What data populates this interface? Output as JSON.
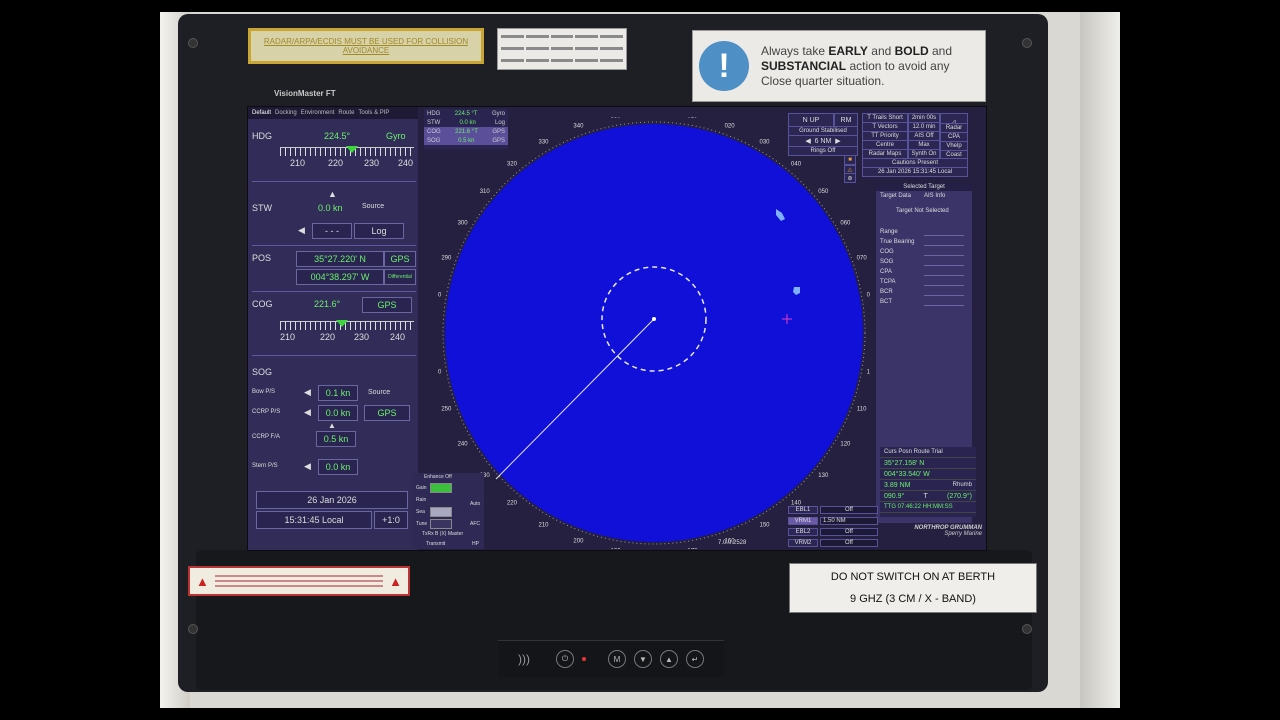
{
  "stickers": {
    "top_left_warning": "RADAR/ARPA/ECDIS MUST BE USED FOR COLLISION AVOIDANCE",
    "tip_line1": "Always take ",
    "tip_early": "EARLY",
    "tip_and": " and ",
    "tip_bold": "BOLD",
    "tip_and2": " and",
    "tip_substancial": "SUBSTANCIAL",
    "tip_line2b": " action to avoid any",
    "tip_line3": "Close quarter situation.",
    "tip_icon": "!",
    "berth_line1": "DO NOT SWITCH ON AT BERTH",
    "berth_line2": "9 GHZ (3 CM / X - BAND)",
    "brand": "VisionMaster FT"
  },
  "tabs": [
    "Default",
    "Docking",
    "Environment",
    "Route",
    "Tools & PIP"
  ],
  "left_panel": {
    "hdg_label": "HDG",
    "hdg_value": "224.5°",
    "hdg_source": "Gyro",
    "hdg_scale": [
      "210",
      "220",
      "230",
      "240"
    ],
    "stw_label": "STW",
    "stw_value": "0.0 kn",
    "stw_source_label": "Source",
    "stw_dots": "- - -",
    "stw_source": "Log",
    "pos_label": "POS",
    "pos_lat": "35°27.220' N",
    "pos_lon": "004°38.297' W",
    "pos_source": "GPS",
    "pos_mode": "Differential",
    "cog_label": "COG",
    "cog_value": "221.6°",
    "cog_source": "GPS",
    "cog_scale": [
      "210",
      "220",
      "230",
      "240"
    ],
    "sog_label": "SOG",
    "bow_label": "Bow P/S",
    "bow_value": "0.1 kn",
    "sog_source_label": "Source",
    "sog_source": "GPS",
    "ccrp_ps_label": "CCRP P/S",
    "ccrp_ps_value": "0.0 kn",
    "ccrp_fa_label": "CCRP F/A",
    "ccrp_fa_value": "0.5 kn",
    "stern_label": "Stern P/S",
    "stern_value": "0.0 kn",
    "date": "26 Jan 2026",
    "time": "15:31:45 Local",
    "tz": "+1:0"
  },
  "top_header": {
    "hdg_label": "HDG",
    "hdg_value": "224.5 °T",
    "hdg_src": "Gyro",
    "stw_label": "STW",
    "stw_value": "0.0 kn",
    "stw_src": "Log",
    "cog_label": "COG",
    "cog_value": "221.6 °T",
    "cog_src": "GPS",
    "sog_label": "SOG",
    "sog_value": "0.5 kn",
    "sog_src": "GPS"
  },
  "radar": {
    "bearings": [
      "350",
      "000",
      "010",
      "020",
      "030",
      "040",
      "050",
      "060",
      "070",
      "080",
      "090",
      "100",
      "110",
      "120",
      "130",
      "140",
      "150",
      "160",
      "170",
      "180",
      "190",
      "200",
      "210",
      "220",
      "230",
      "240",
      "250",
      "260",
      "270",
      "280",
      "290",
      "300",
      "310",
      "320",
      "330",
      "340"
    ],
    "version": "7.0.0.2528",
    "sweep_color": "#1010d8"
  },
  "right_panel": {
    "n_up": "N UP",
    "rm": "RM",
    "ground_stab": "Ground Stabilised",
    "range": "6 NM",
    "rings": "Rings Off",
    "t_trails": "T Trails Short",
    "trails_val": "2min 00s",
    "t_vectors": "T Vectors",
    "vectors_val": "12.0 min",
    "tt_priority": "TT Priority",
    "ais_off": "AIS Off",
    "centre": "Centre",
    "max": "Max",
    "radar_maps": "Radar Maps",
    "synth_on": "Synth On",
    "coast": "Coast",
    "cautions": "Cautions Present",
    "date_line": "26 Jan 2026 15:31:45 Local",
    "radar_btn": "Radar",
    "cpa_btn": "CPA",
    "vhelp": "Vhelp"
  },
  "target_panel": {
    "header": "Selected Target",
    "tab1": "Target Data",
    "tab2": "AIS Info",
    "status": "Target Not Selected",
    "fields": [
      "Range",
      "True Bearing",
      "COG",
      "SOG",
      "CPA",
      "TCPA",
      "BCR",
      "BCT"
    ]
  },
  "cursor_panel": {
    "tabs": "Curs  Posn  Route  Trial",
    "lat": "35°27.158' N",
    "lon": "004°33.540' W",
    "dist": "3.89 NM",
    "dist_mode": "Rhumb",
    "brg": "090.9°",
    "brg_t": "T",
    "brg_rel": "(270.9°)",
    "ttg": "TTG 07:46:22 HH:MM:SS"
  },
  "ebl_vrm": {
    "ebl1": "EBL1",
    "ebl1_v": "Off",
    "vrm1": "VRM1",
    "vrm1_v": "1.50 NM",
    "ebl2": "EBL2",
    "ebl2_v": "Off",
    "vrm2": "VRM2",
    "vrm2_v": "Off"
  },
  "enhance": {
    "title": "Enhance Off",
    "gain": "Gain",
    "rain": "Rain",
    "sea": "Sea",
    "tune": "Tune",
    "auto": "Auto",
    "afc": "AFC",
    "txrx": "TxRx B (X) Master",
    "transmit": "Transmit",
    "hp": "HP"
  },
  "logo": {
    "name": "NORTHROP GRUMMAN",
    "sub": "Sperry Marine"
  },
  "colors": {
    "panel": "#322d58",
    "green": "#6cf06c",
    "radar_blue": "#1010d8",
    "bezel": "#1d1f24"
  }
}
